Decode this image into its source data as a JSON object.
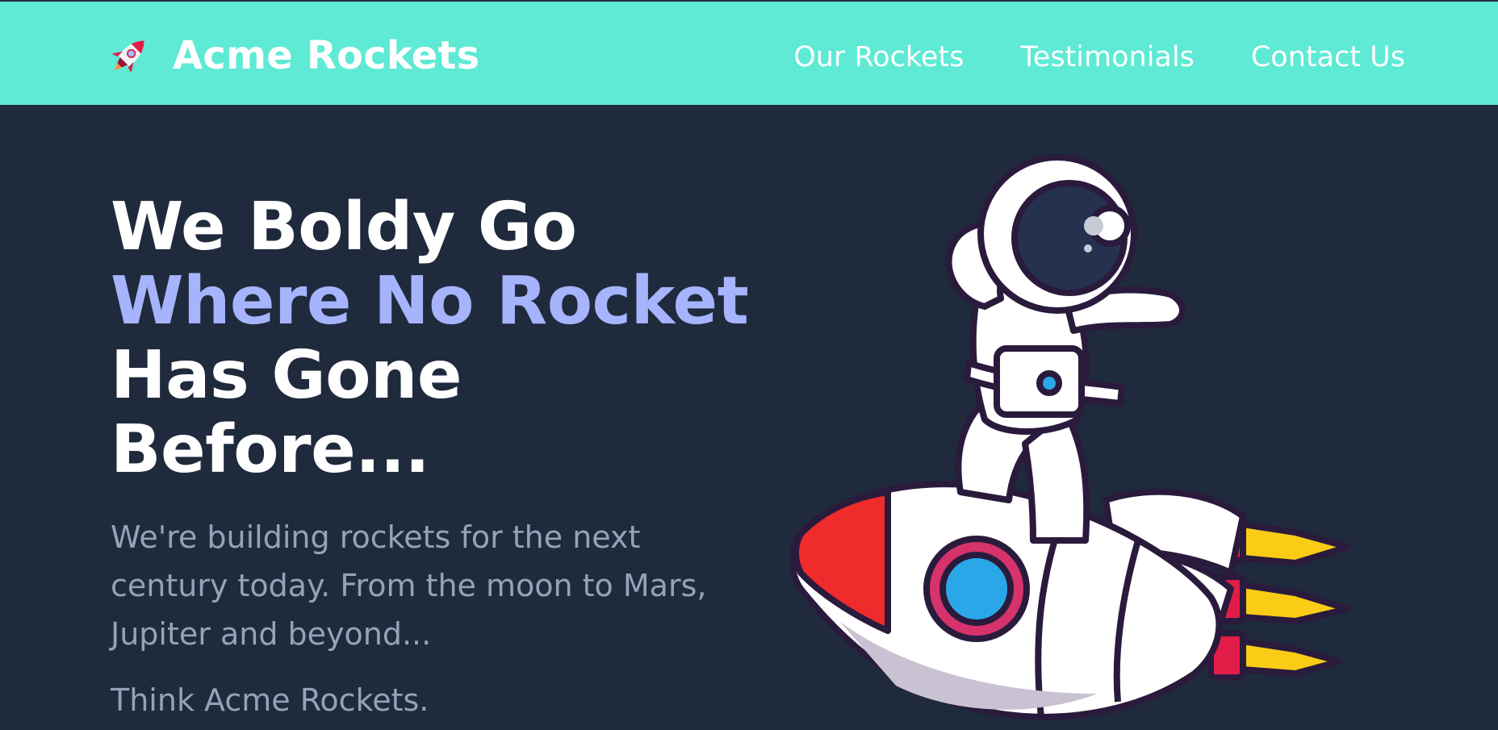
{
  "header": {
    "brand_name": "Acme Rockets",
    "logo_icon": "rocket-icon",
    "nav": [
      {
        "label": "Our Rockets"
      },
      {
        "label": "Testimonials"
      },
      {
        "label": "Contact Us"
      }
    ]
  },
  "hero": {
    "title_line1": "We Boldy Go",
    "title_line2": "Where No Rocket",
    "title_line3": "Has Gone",
    "title_line4": "Before...",
    "description": "We're building rockets for the next century today. From the moon to Mars, Jupiter and beyond...",
    "tagline": "Think Acme Rockets.",
    "illustration_icon": "astronaut-on-rocket-illustration"
  },
  "colors": {
    "header_bg": "#5eead4",
    "page_bg": "#1f2a3c",
    "accent": "#a5b4fc",
    "muted_text": "#94a3b8"
  }
}
